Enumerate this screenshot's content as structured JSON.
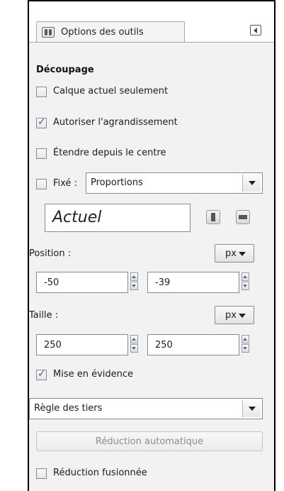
{
  "tab": {
    "label": "Options des outils",
    "icon": "tool-options-icon",
    "menu_icon": "panel-menu-icon"
  },
  "section_title": "Découpage",
  "options": {
    "current_layer_only": {
      "label": "Calque actuel seulement",
      "checked": false
    },
    "allow_growing": {
      "label": "Autoriser l'agrandissement",
      "checked": true
    },
    "expand_from_center": {
      "label": "Étendre depuis le centre",
      "checked": false
    },
    "fixed": {
      "label": "Fixé :",
      "checked": false,
      "value": "Proportions"
    }
  },
  "aspect": {
    "value": "Actuel",
    "portrait_icon": "portrait-icon",
    "landscape_icon": "landscape-icon"
  },
  "position": {
    "label": "Position :",
    "unit": "px",
    "x": "-50",
    "y": "-39"
  },
  "size": {
    "label": "Taille :",
    "unit": "px",
    "width": "250",
    "height": "250"
  },
  "highlight": {
    "label": "Mise en évidence",
    "checked": true
  },
  "guides": {
    "value": "Règle des tiers"
  },
  "auto_shrink": {
    "label": "Réduction automatique"
  },
  "shrink_merged": {
    "label": "Réduction fusionnée",
    "checked": false
  }
}
